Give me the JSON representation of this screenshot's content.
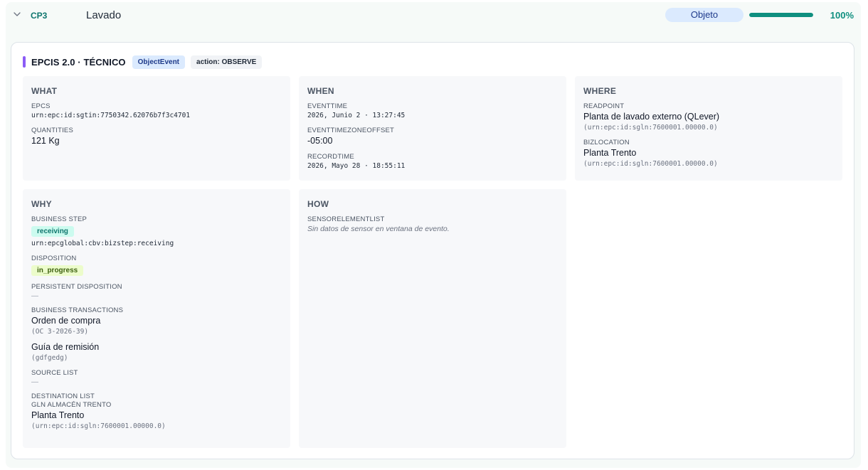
{
  "step": {
    "code": "CP3",
    "name": "Lavado",
    "type_label": "Objeto",
    "progress_percent": 100,
    "progress_label": "100%"
  },
  "card": {
    "title": "EPCIS 2.0 · TÉCNICO",
    "event_badge": "ObjectEvent",
    "action_badge": "action: OBSERVE"
  },
  "what": {
    "title": "WHAT",
    "epcs_label": "EPCS",
    "epcs_value": "urn:epc:id:sgtin:7750342.62076b7f3c4701",
    "quantities_label": "QUANTITIES",
    "quantities_value": "121 Kg"
  },
  "when": {
    "title": "WHEN",
    "eventtime_label": "EVENTTIME",
    "eventtime_value": "2026, Junio 2 · 13:27:45",
    "offset_label": "EVENTTIMEZONEOFFSET",
    "offset_value": "-05:00",
    "recordtime_label": "RECORDTIME",
    "recordtime_value": "2026, Mayo 28 · 18:55:11"
  },
  "where": {
    "title": "WHERE",
    "readpoint_label": "READPOINT",
    "readpoint_name": "Planta de lavado externo (QLever)",
    "readpoint_urn": "(urn:epc:id:sgln:7600001.00000.0)",
    "bizlocation_label": "BIZLOCATION",
    "bizlocation_name": "Planta Trento",
    "bizlocation_urn": "(urn:epc:id:sgln:7600001.00000.0)"
  },
  "why": {
    "title": "WHY",
    "business_step_label": "BUSINESS STEP",
    "business_step_chip": "receiving",
    "business_step_urn": "urn:epcglobal:cbv:bizstep:receiving",
    "disposition_label": "DISPOSITION",
    "disposition_chip": "in_progress",
    "persistent_label": "PERSISTENT DISPOSITION",
    "persistent_value": "—",
    "transactions_label": "BUSINESS TRANSACTIONS",
    "transactions": [
      {
        "name": "Orden de compra",
        "ref": "(OC 3-2026-39)"
      },
      {
        "name": "Guía de remisión",
        "ref": "(gdfgedg)"
      }
    ],
    "source_label": "SOURCE LIST",
    "source_value": "—",
    "destination_label": "DESTINATION LIST",
    "destination_sub_label": "GLN ALMACÉN TRENTO",
    "destination_name": "Planta Trento",
    "destination_urn": "(urn:epc:id:sgln:7600001.00000.0)"
  },
  "how": {
    "title": "HOW",
    "sensor_label": "SENSORELEMENTLIST",
    "sensor_note": "Sin datos de sensor en ventana de evento."
  },
  "colors": {
    "accent": "#8b5cf6",
    "progress": "#0f8f7f",
    "type_pill_bg": "#dbeafe"
  },
  "icons": {
    "collapse": "chevron-down-icon"
  }
}
